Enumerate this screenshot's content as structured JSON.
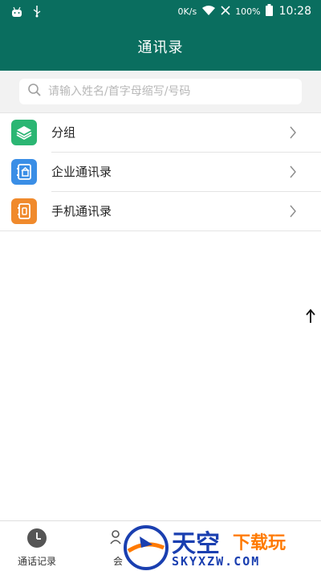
{
  "status_bar": {
    "network_speed": "0K/s",
    "battery": "100%",
    "time": "10:28"
  },
  "app_bar": {
    "title": "通讯录"
  },
  "search": {
    "placeholder": "请输入姓名/首字母缩写/号码",
    "value": ""
  },
  "menu": {
    "items": [
      {
        "label": "分组",
        "icon": "layers-icon",
        "color": "#2bb673"
      },
      {
        "label": "企业通讯录",
        "icon": "building-book-icon",
        "color": "#3a8ee6"
      },
      {
        "label": "手机通讯录",
        "icon": "phone-book-icon",
        "color": "#f08a2c"
      }
    ]
  },
  "bottom_nav": {
    "items": [
      {
        "label": "通话记录",
        "icon": "clock-icon"
      },
      {
        "label": "会",
        "icon": "meeting-icon"
      }
    ]
  },
  "watermark": {
    "title": "天空",
    "subtitle": "下载玩",
    "site": "SKYXZW.COM"
  },
  "colors": {
    "primary": "#0a6e5f",
    "background": "#ffffff",
    "search_bg": "#f2f2f2"
  }
}
